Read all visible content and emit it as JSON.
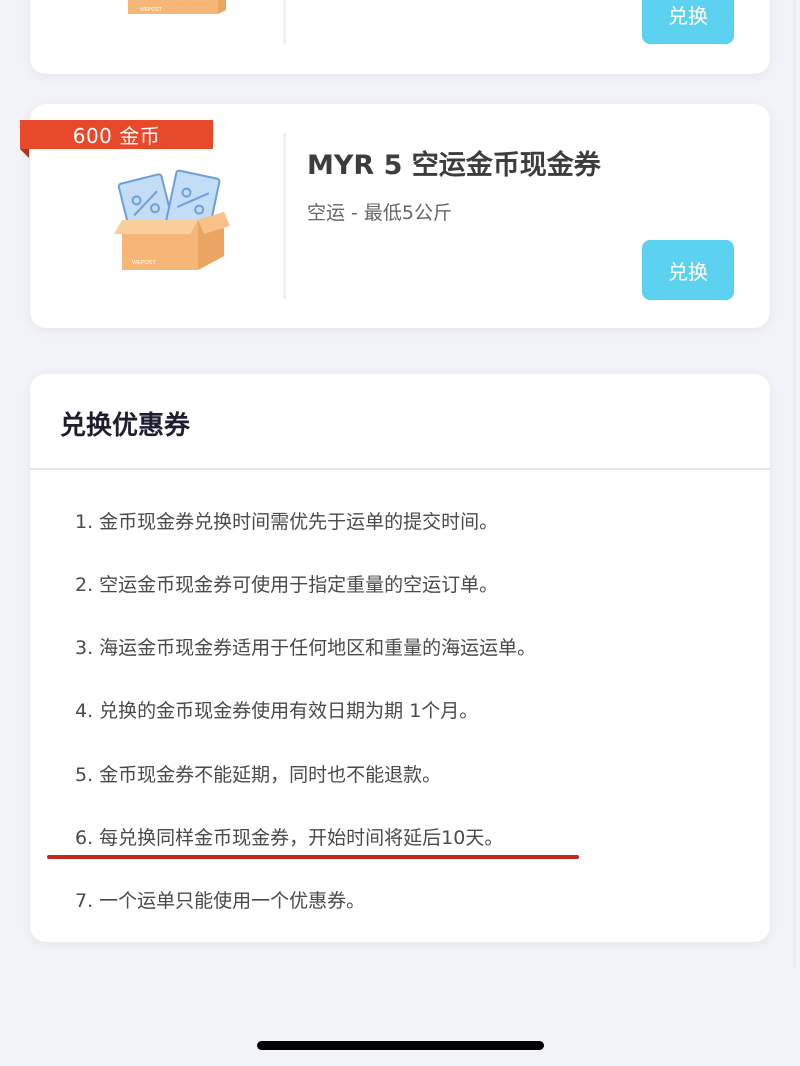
{
  "top_card": {
    "button_label": "兑换"
  },
  "coupon": {
    "badge": "600 金币",
    "title": "MYR 5 空运金币现金券",
    "subtitle": "空运 - 最低5公斤",
    "button_label": "兑换"
  },
  "rules": {
    "title": "兑换优惠券",
    "items": [
      "1. 金币现金券兑换时间需优先于运单的提交时间。",
      "2. 空运金币现金券可使用于指定重量的空运订单。",
      "3. 海运金币现金券适用于任何地区和重量的海运运单。",
      "4. 兑换的金币现金券使用有效日期为期 1个月。",
      "5. 金币现金券不能延期，同时也不能退款。",
      "6. 每兑换同样金币现金券，开始时间将延后10天。",
      "7. 一个运单只能使用一个优惠券。"
    ]
  },
  "colors": {
    "button": "#5dd2f0",
    "badge": "#e8492a",
    "box": "#f6b677",
    "ticket": "#a9cdef",
    "highlight_underline": "#c0281a"
  },
  "icons": {
    "coupon_box": "coupon-box-illustration",
    "box_logo_text": "WEPOST"
  }
}
